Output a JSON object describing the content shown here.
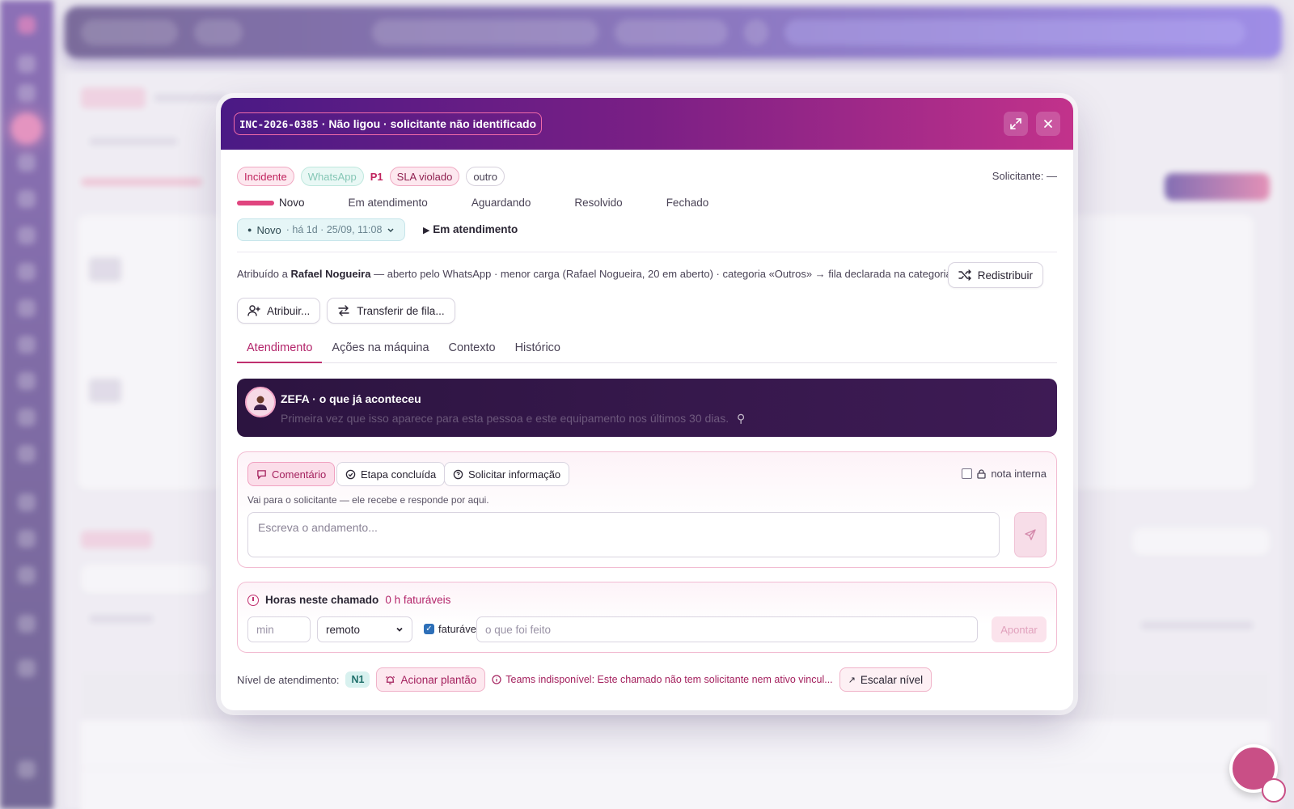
{
  "ticket": {
    "code": "INC-2026-0385",
    "title": "· Não ligou · solicitante não identificado"
  },
  "chips": {
    "type": "Incidente",
    "channel": "WhatsApp",
    "priority": "P1",
    "sla": "SLA violado",
    "category": "outro"
  },
  "requester": "Solicitante: —",
  "steps": [
    "Novo",
    "Em atendimento",
    "Aguardando",
    "Resolvido",
    "Fechado"
  ],
  "status": {
    "current": "Novo",
    "since": "· há 1d · 25/09, 11:08",
    "next_action": "Em atendimento"
  },
  "assignment": {
    "prefix": "Atribuído a",
    "agent": "Rafael Nogueira",
    "detail": "— aberto pelo WhatsApp · menor carga (Rafael Nogueira, 20 em aberto) · categoria «Outros» → fila declarada na categoria",
    "redistribute": "Redistribuir",
    "assign": "Atribuir...",
    "transfer": "Transferir de fila..."
  },
  "tabs": [
    "Atendimento",
    "Ações na máquina",
    "Contexto",
    "Histórico"
  ],
  "zefa": {
    "title": "ZEFA · o que já aconteceu",
    "text": "Primeira vez que isso aparece para esta pessoa e este equipamento nos últimos 30 dias."
  },
  "comment": {
    "options": [
      "Comentário",
      "Etapa concluída",
      "Solicitar informação"
    ],
    "internal_note": "nota interna",
    "hint": "Vai para o solicitante — ele recebe e responde por aqui.",
    "placeholder": "Escreva o andamento..."
  },
  "hours": {
    "title": "Horas neste chamado",
    "billable_total": "0 h faturáveis",
    "min_placeholder": "min",
    "mode": "remoto",
    "billable_label": "faturável",
    "desc_placeholder": "o que foi feito",
    "submit": "Apontar"
  },
  "level": {
    "label": "Nível de atendimento:",
    "value": "N1",
    "on_call": "Acionar plantão",
    "teams_msg": "Teams indisponível: Este chamado não tem solicitante nem ativo vincul...",
    "escalate": "Escalar nível"
  },
  "colors": {
    "header_start": "#4a1a85",
    "header_end": "#c2328b",
    "accent": "#c0306f",
    "zefa_bg": "#2c1440"
  }
}
